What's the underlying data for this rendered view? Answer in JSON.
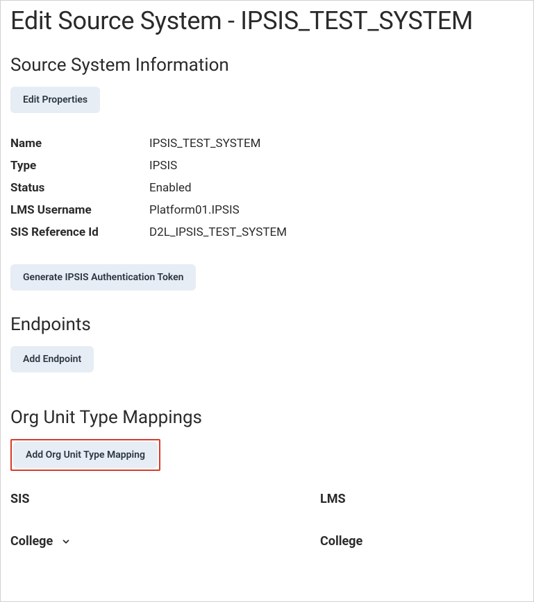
{
  "page": {
    "title": "Edit Source System - IPSIS_TEST_SYSTEM"
  },
  "sections": {
    "source_info": {
      "title": "Source System Information",
      "edit_properties_label": "Edit Properties",
      "generate_token_label": "Generate IPSIS Authentication Token",
      "fields": {
        "name": {
          "label": "Name",
          "value": "IPSIS_TEST_SYSTEM"
        },
        "type": {
          "label": "Type",
          "value": "IPSIS"
        },
        "status": {
          "label": "Status",
          "value": "Enabled"
        },
        "lms_username": {
          "label": "LMS Username",
          "value": "Platform01.IPSIS"
        },
        "sis_reference_id": {
          "label": "SIS Reference Id",
          "value": "D2L_IPSIS_TEST_SYSTEM"
        }
      }
    },
    "endpoints": {
      "title": "Endpoints",
      "add_endpoint_label": "Add Endpoint"
    },
    "org_mappings": {
      "title": "Org Unit Type Mappings",
      "add_mapping_label": "Add Org Unit Type Mapping",
      "headers": {
        "sis": "SIS",
        "lms": "LMS"
      },
      "rows": [
        {
          "sis": "College",
          "lms": "College"
        }
      ]
    }
  }
}
